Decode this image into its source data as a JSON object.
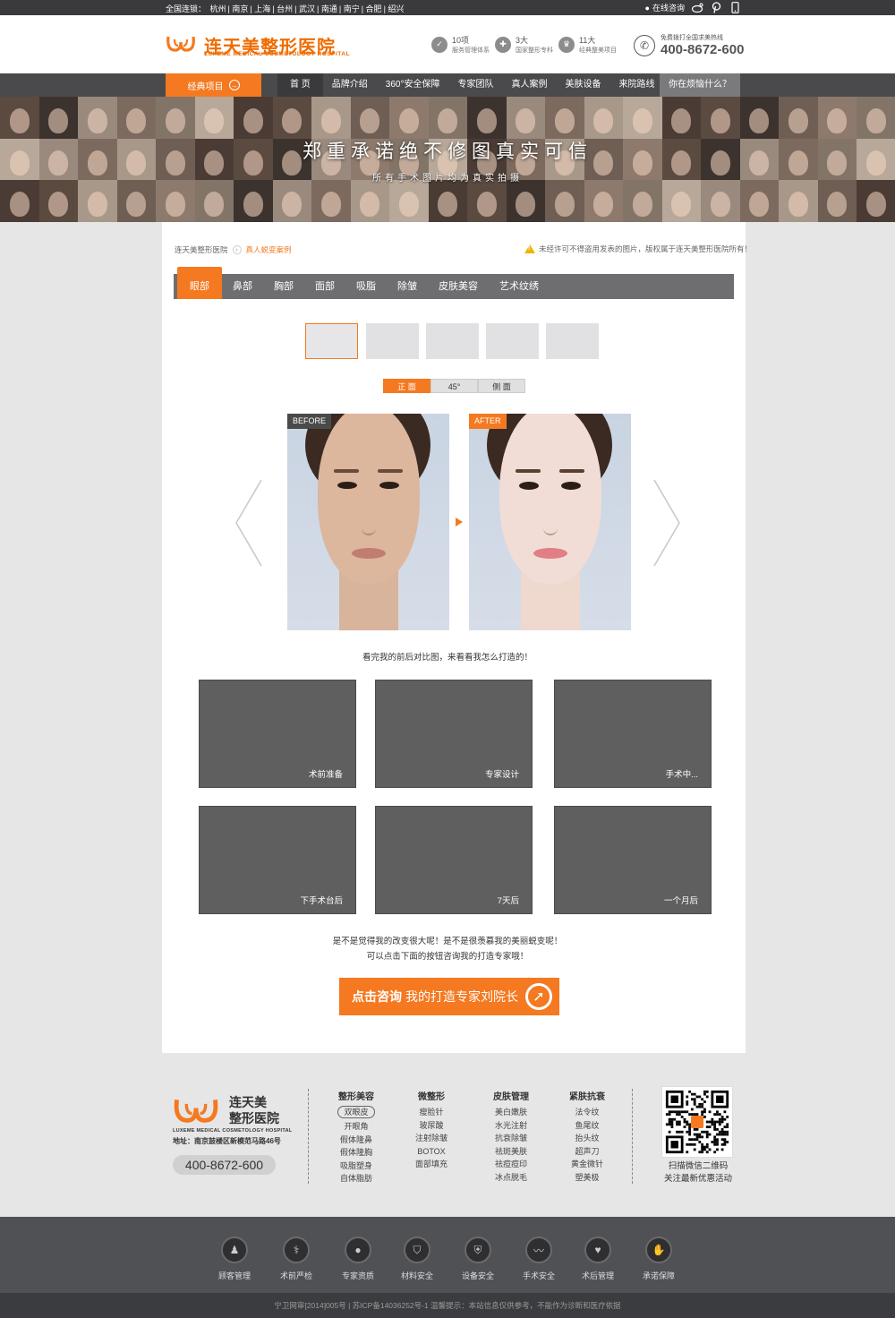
{
  "topbar": {
    "cities_label": "全国连锁：",
    "cities": [
      "杭州",
      "南京",
      "上海",
      "台州",
      "武汉",
      "南通",
      "南宁",
      "合肥",
      "绍兴"
    ],
    "online_consult": "在线咨询"
  },
  "header": {
    "brand_cn": "连天美整形医院",
    "brand_en": "LUXEME MEDICAL COSMETOLOGY HOSPITAL",
    "features": [
      {
        "top": "10项",
        "bottom": "服务管理体系"
      },
      {
        "top": "3大",
        "bottom": "国家整形专科"
      },
      {
        "top": "11大",
        "bottom": "经典整美项目"
      }
    ],
    "hotline_label": "免费拨打全国求美热线",
    "hotline": "400-8672-600"
  },
  "nav": {
    "classic": "经典项目",
    "items": [
      "首 页",
      "品牌介绍",
      "360°安全保障",
      "专家团队",
      "真人案例",
      "美肤设备",
      "来院路线"
    ],
    "trouble": "你在烦恼什么？"
  },
  "banner": {
    "title": "郑重承诺绝不修图真实可信",
    "subtitle": "所有手术图片均为真实拍摄"
  },
  "breadcrumb": {
    "home": "连天美整形医院",
    "current": "真人蜕变案例"
  },
  "notice": "未经许可不得盗用发表的图片，版权属于连天美整形医院所有！",
  "categories": [
    "眼部",
    "鼻部",
    "胸部",
    "面部",
    "吸脂",
    "除皱",
    "皮肤美容",
    "艺术纹绣"
  ],
  "angles": [
    "正 面",
    "45°",
    "侧 面"
  ],
  "compare": {
    "before": "BEFORE",
    "after": "AFTER"
  },
  "caption": "看完我的前后对比图，来看看我怎么打造的！",
  "steps": [
    "术前准备",
    "专家设计",
    "手术中...",
    "下手术台后",
    "7天后",
    "一个月后"
  ],
  "prompt1": "是不是觉得我的改变很大呢！是不是很羡慕我的美丽蜕变呢！",
  "prompt2": "可以点击下面的按钮咨询我的打造专家哦！",
  "cta": {
    "bold": "点击咨询",
    "rest": "我的打造专家刘院长"
  },
  "footer": {
    "brand_l1": "连天美",
    "brand_l2": "整形医院",
    "brand_en": "LUXEME MEDICAL COSMETOLOGY HOSPITAL",
    "address": "地址：南京鼓楼区新模范马路46号",
    "phone": "400-8672-600",
    "columns": [
      {
        "title": "整形美容",
        "items": [
          "双眼皮",
          "开眼角",
          "假体隆鼻",
          "假体隆胸",
          "吸脂塑身",
          "自体脂肪"
        ]
      },
      {
        "title": "微整形",
        "items": [
          "瘦脸针",
          "玻尿酸",
          "注射除皱",
          "BOTOX",
          "面部填充"
        ]
      },
      {
        "title": "皮肤管理",
        "items": [
          "美白嫩肤",
          "水光注射",
          "抗衰除皱",
          "祛斑美肤",
          "祛痘痘印",
          "冰点脱毛"
        ]
      },
      {
        "title": "紧肤抗衰",
        "items": [
          "法令纹",
          "鱼尾纹",
          "抬头纹",
          "超声刀",
          "黄金微针",
          "塑美极"
        ]
      }
    ],
    "qr_l1": "扫描微信二维码",
    "qr_l2": "关注最新优惠活动",
    "guarantees": [
      "顾客管理",
      "术前严检",
      "专家资质",
      "材料安全",
      "设备安全",
      "手术安全",
      "术后管理",
      "承诺保障"
    ],
    "copyright": "宁卫网审[2014]005号 | 苏ICP备14036252号-1    温馨提示：本站信息仅供参考，不能作为诊断和医疗依据"
  },
  "colors": {
    "accent": "#f47920",
    "nav": "#4a4a4c",
    "tile": "#5f5f5f"
  }
}
